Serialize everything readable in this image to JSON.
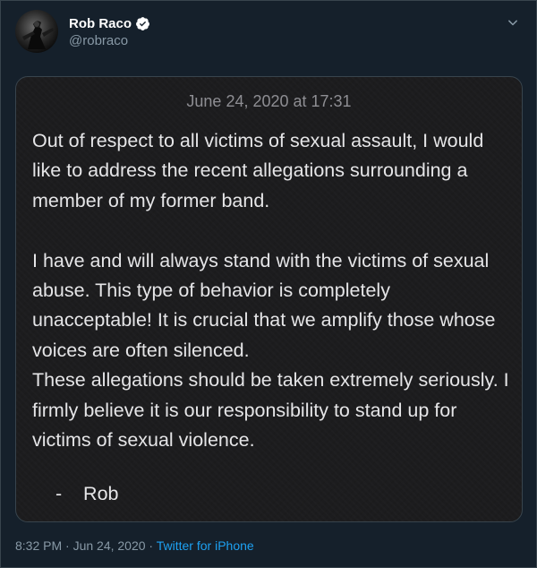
{
  "author": {
    "display_name": "Rob Raco",
    "handle": "@robraco",
    "verified": true
  },
  "menu": {
    "icon": "chevron-down-icon"
  },
  "note": {
    "date": "June 24, 2020 at 17:31",
    "paragraph_1": "Out of respect to all victims of sexual assault, I would like to address the recent allegations surrounding a member of my former band.",
    "paragraph_2": "I have and will always stand with the victims of sexual abuse. This type of behavior is completely unacceptable! It is crucial that we amplify those whose voices are often silenced.",
    "paragraph_3": "These allegations should be taken extremely seriously. I firmly believe it is our responsibility to stand up for victims of sexual violence.",
    "signoff": "-    Rob"
  },
  "footer": {
    "timestamp": "8:32 PM · Jun 24, 2020 · ",
    "source": "Twitter for iPhone"
  },
  "colors": {
    "background": "#15202b",
    "accent": "#1da1f2",
    "secondary_text": "#8899a6"
  }
}
